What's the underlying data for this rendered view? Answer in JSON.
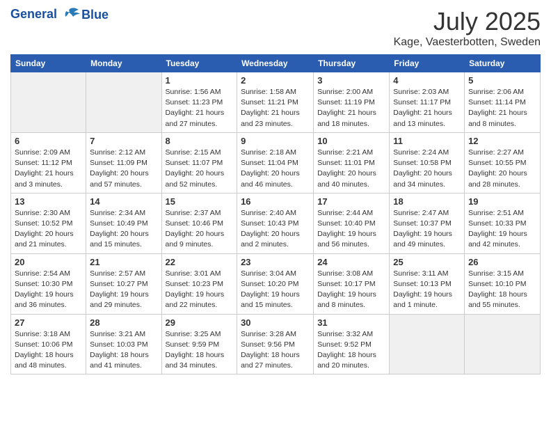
{
  "header": {
    "logo_line1": "General",
    "logo_line2": "Blue",
    "month": "July 2025",
    "location": "Kage, Vaesterbotten, Sweden"
  },
  "weekdays": [
    "Sunday",
    "Monday",
    "Tuesday",
    "Wednesday",
    "Thursday",
    "Friday",
    "Saturday"
  ],
  "weeks": [
    [
      {
        "day": "",
        "info": ""
      },
      {
        "day": "",
        "info": ""
      },
      {
        "day": "1",
        "info": "Sunrise: 1:56 AM\nSunset: 11:23 PM\nDaylight: 21 hours and 27 minutes."
      },
      {
        "day": "2",
        "info": "Sunrise: 1:58 AM\nSunset: 11:21 PM\nDaylight: 21 hours and 23 minutes."
      },
      {
        "day": "3",
        "info": "Sunrise: 2:00 AM\nSunset: 11:19 PM\nDaylight: 21 hours and 18 minutes."
      },
      {
        "day": "4",
        "info": "Sunrise: 2:03 AM\nSunset: 11:17 PM\nDaylight: 21 hours and 13 minutes."
      },
      {
        "day": "5",
        "info": "Sunrise: 2:06 AM\nSunset: 11:14 PM\nDaylight: 21 hours and 8 minutes."
      }
    ],
    [
      {
        "day": "6",
        "info": "Sunrise: 2:09 AM\nSunset: 11:12 PM\nDaylight: 21 hours and 3 minutes."
      },
      {
        "day": "7",
        "info": "Sunrise: 2:12 AM\nSunset: 11:09 PM\nDaylight: 20 hours and 57 minutes."
      },
      {
        "day": "8",
        "info": "Sunrise: 2:15 AM\nSunset: 11:07 PM\nDaylight: 20 hours and 52 minutes."
      },
      {
        "day": "9",
        "info": "Sunrise: 2:18 AM\nSunset: 11:04 PM\nDaylight: 20 hours and 46 minutes."
      },
      {
        "day": "10",
        "info": "Sunrise: 2:21 AM\nSunset: 11:01 PM\nDaylight: 20 hours and 40 minutes."
      },
      {
        "day": "11",
        "info": "Sunrise: 2:24 AM\nSunset: 10:58 PM\nDaylight: 20 hours and 34 minutes."
      },
      {
        "day": "12",
        "info": "Sunrise: 2:27 AM\nSunset: 10:55 PM\nDaylight: 20 hours and 28 minutes."
      }
    ],
    [
      {
        "day": "13",
        "info": "Sunrise: 2:30 AM\nSunset: 10:52 PM\nDaylight: 20 hours and 21 minutes."
      },
      {
        "day": "14",
        "info": "Sunrise: 2:34 AM\nSunset: 10:49 PM\nDaylight: 20 hours and 15 minutes."
      },
      {
        "day": "15",
        "info": "Sunrise: 2:37 AM\nSunset: 10:46 PM\nDaylight: 20 hours and 9 minutes."
      },
      {
        "day": "16",
        "info": "Sunrise: 2:40 AM\nSunset: 10:43 PM\nDaylight: 20 hours and 2 minutes."
      },
      {
        "day": "17",
        "info": "Sunrise: 2:44 AM\nSunset: 10:40 PM\nDaylight: 19 hours and 56 minutes."
      },
      {
        "day": "18",
        "info": "Sunrise: 2:47 AM\nSunset: 10:37 PM\nDaylight: 19 hours and 49 minutes."
      },
      {
        "day": "19",
        "info": "Sunrise: 2:51 AM\nSunset: 10:33 PM\nDaylight: 19 hours and 42 minutes."
      }
    ],
    [
      {
        "day": "20",
        "info": "Sunrise: 2:54 AM\nSunset: 10:30 PM\nDaylight: 19 hours and 36 minutes."
      },
      {
        "day": "21",
        "info": "Sunrise: 2:57 AM\nSunset: 10:27 PM\nDaylight: 19 hours and 29 minutes."
      },
      {
        "day": "22",
        "info": "Sunrise: 3:01 AM\nSunset: 10:23 PM\nDaylight: 19 hours and 22 minutes."
      },
      {
        "day": "23",
        "info": "Sunrise: 3:04 AM\nSunset: 10:20 PM\nDaylight: 19 hours and 15 minutes."
      },
      {
        "day": "24",
        "info": "Sunrise: 3:08 AM\nSunset: 10:17 PM\nDaylight: 19 hours and 8 minutes."
      },
      {
        "day": "25",
        "info": "Sunrise: 3:11 AM\nSunset: 10:13 PM\nDaylight: 19 hours and 1 minute."
      },
      {
        "day": "26",
        "info": "Sunrise: 3:15 AM\nSunset: 10:10 PM\nDaylight: 18 hours and 55 minutes."
      }
    ],
    [
      {
        "day": "27",
        "info": "Sunrise: 3:18 AM\nSunset: 10:06 PM\nDaylight: 18 hours and 48 minutes."
      },
      {
        "day": "28",
        "info": "Sunrise: 3:21 AM\nSunset: 10:03 PM\nDaylight: 18 hours and 41 minutes."
      },
      {
        "day": "29",
        "info": "Sunrise: 3:25 AM\nSunset: 9:59 PM\nDaylight: 18 hours and 34 minutes."
      },
      {
        "day": "30",
        "info": "Sunrise: 3:28 AM\nSunset: 9:56 PM\nDaylight: 18 hours and 27 minutes."
      },
      {
        "day": "31",
        "info": "Sunrise: 3:32 AM\nSunset: 9:52 PM\nDaylight: 18 hours and 20 minutes."
      },
      {
        "day": "",
        "info": ""
      },
      {
        "day": "",
        "info": ""
      }
    ]
  ]
}
